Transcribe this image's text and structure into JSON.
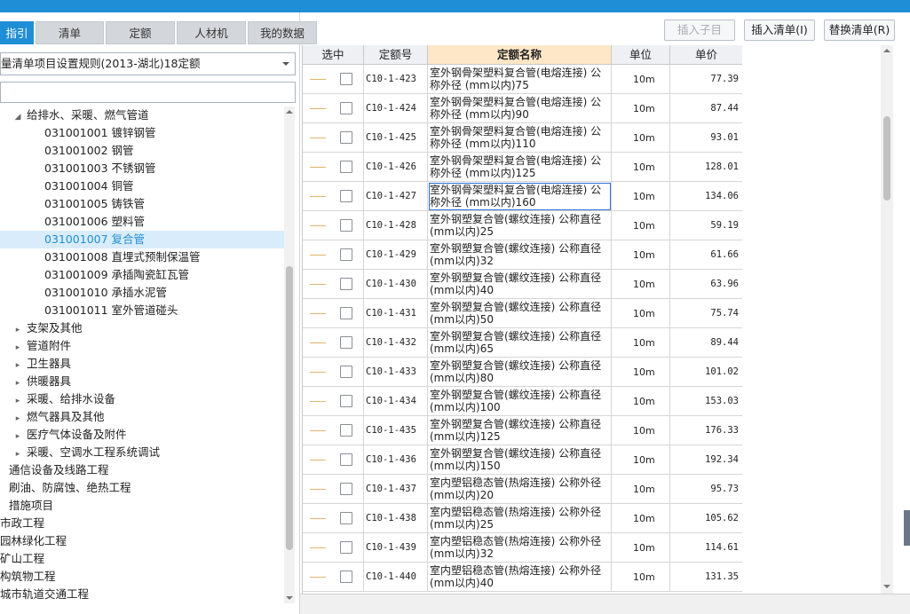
{
  "tabs": [
    "指引",
    "清单",
    "定额",
    "人材机",
    "我的数据"
  ],
  "rule_select": "量清单项目设置规则(2013-湖北)18定额",
  "search_placeholder": "",
  "tree": [
    {
      "label": "给排水、采暖、燃气管道",
      "toggle": "◢",
      "indent": 14,
      "selected": false
    },
    {
      "label": "031001001  镀锌钢管",
      "toggle": "",
      "indent": 50,
      "selected": false
    },
    {
      "label": "031001002  钢管",
      "toggle": "",
      "indent": 50,
      "selected": false
    },
    {
      "label": "031001003  不锈钢管",
      "toggle": "",
      "indent": 50,
      "selected": false
    },
    {
      "label": "031001004  铜管",
      "toggle": "",
      "indent": 50,
      "selected": false
    },
    {
      "label": "031001005  铸铁管",
      "toggle": "",
      "indent": 50,
      "selected": false
    },
    {
      "label": "031001006  塑料管",
      "toggle": "",
      "indent": 50,
      "selected": false
    },
    {
      "label": "031001007  复合管",
      "toggle": "",
      "indent": 50,
      "selected": true
    },
    {
      "label": "031001008  直埋式预制保温管",
      "toggle": "",
      "indent": 50,
      "selected": false
    },
    {
      "label": "031001009  承插陶瓷缸瓦管",
      "toggle": "",
      "indent": 50,
      "selected": false
    },
    {
      "label": "031001010  承插水泥管",
      "toggle": "",
      "indent": 50,
      "selected": false
    },
    {
      "label": "031001011  室外管道碰头",
      "toggle": "",
      "indent": 50,
      "selected": false
    },
    {
      "label": "支架及其他",
      "toggle": "▸",
      "indent": 14,
      "selected": false
    },
    {
      "label": "管道附件",
      "toggle": "▸",
      "indent": 14,
      "selected": false
    },
    {
      "label": "卫生器具",
      "toggle": "▸",
      "indent": 14,
      "selected": false
    },
    {
      "label": "供暖器具",
      "toggle": "▸",
      "indent": 14,
      "selected": false
    },
    {
      "label": "采暖、给排水设备",
      "toggle": "▸",
      "indent": 14,
      "selected": false
    },
    {
      "label": "燃气器具及其他",
      "toggle": "▸",
      "indent": 14,
      "selected": false
    },
    {
      "label": "医疗气体设备及附件",
      "toggle": "▸",
      "indent": 14,
      "selected": false
    },
    {
      "label": "采暖、空调水工程系统调试",
      "toggle": "▸",
      "indent": 14,
      "selected": false
    },
    {
      "label": "通信设备及线路工程",
      "toggle": "",
      "indent": 10,
      "selected": false
    },
    {
      "label": "刷油、防腐蚀、绝热工程",
      "toggle": "",
      "indent": 10,
      "selected": false
    },
    {
      "label": "措施项目",
      "toggle": "",
      "indent": 10,
      "selected": false
    },
    {
      "label": "市政工程",
      "toggle": "",
      "indent": 0,
      "selected": false
    },
    {
      "label": "园林绿化工程",
      "toggle": "",
      "indent": 0,
      "selected": false
    },
    {
      "label": "矿山工程",
      "toggle": "",
      "indent": 0,
      "selected": false
    },
    {
      "label": "构筑物工程",
      "toggle": "",
      "indent": 0,
      "selected": false
    },
    {
      "label": "城市轨道交通工程",
      "toggle": "",
      "indent": 0,
      "selected": false
    }
  ],
  "buttons": {
    "insert_child": "插入子目",
    "insert_list": "插入清单(I)",
    "replace_list": "替换清单(R)"
  },
  "columns": {
    "select": "选中",
    "code": "定额号",
    "name": "定额名称",
    "unit": "单位",
    "price": "单价"
  },
  "rows": [
    {
      "code": "C10-1-423",
      "name": "室外钢骨架塑料复合管(电熔连接) 公称外径 (mm以内)75",
      "unit": "10m",
      "price": "77.39"
    },
    {
      "code": "C10-1-424",
      "name": "室外钢骨架塑料复合管(电熔连接) 公称外径 (mm以内)90",
      "unit": "10m",
      "price": "87.44"
    },
    {
      "code": "C10-1-425",
      "name": "室外钢骨架塑料复合管(电熔连接) 公称外径 (mm以内)110",
      "unit": "10m",
      "price": "93.01"
    },
    {
      "code": "C10-1-426",
      "name": "室外钢骨架塑料复合管(电熔连接) 公称外径 (mm以内)125",
      "unit": "10m",
      "price": "128.01"
    },
    {
      "code": "C10-1-427",
      "name": "室外钢骨架塑料复合管(电熔连接) 公称外径 (mm以内)160",
      "unit": "10m",
      "price": "134.06"
    },
    {
      "code": "C10-1-428",
      "name": "室外钢塑复合管(螺纹连接) 公称直径 (mm以内)25",
      "unit": "10m",
      "price": "59.19"
    },
    {
      "code": "C10-1-429",
      "name": "室外钢塑复合管(螺纹连接) 公称直径 (mm以内)32",
      "unit": "10m",
      "price": "61.66"
    },
    {
      "code": "C10-1-430",
      "name": "室外钢塑复合管(螺纹连接) 公称直径 (mm以内)40",
      "unit": "10m",
      "price": "63.96"
    },
    {
      "code": "C10-1-431",
      "name": "室外钢塑复合管(螺纹连接) 公称直径 (mm以内)50",
      "unit": "10m",
      "price": "75.74"
    },
    {
      "code": "C10-1-432",
      "name": "室外钢塑复合管(螺纹连接) 公称直径 (mm以内)65",
      "unit": "10m",
      "price": "89.44"
    },
    {
      "code": "C10-1-433",
      "name": "室外钢塑复合管(螺纹连接) 公称直径 (mm以内)80",
      "unit": "10m",
      "price": "101.02"
    },
    {
      "code": "C10-1-434",
      "name": "室外钢塑复合管(螺纹连接) 公称直径 (mm以内)100",
      "unit": "10m",
      "price": "153.03"
    },
    {
      "code": "C10-1-435",
      "name": "室外钢塑复合管(螺纹连接) 公称直径 (mm以内)125",
      "unit": "10m",
      "price": "176.33"
    },
    {
      "code": "C10-1-436",
      "name": "室外钢塑复合管(螺纹连接) 公称直径 (mm以内)150",
      "unit": "10m",
      "price": "192.34"
    },
    {
      "code": "C10-1-437",
      "name": "室内塑铝稳态管(热熔连接) 公称外径 (mm以内)20",
      "unit": "10m",
      "price": "95.73"
    },
    {
      "code": "C10-1-438",
      "name": "室内塑铝稳态管(热熔连接) 公称外径 (mm以内)25",
      "unit": "10m",
      "price": "105.62"
    },
    {
      "code": "C10-1-439",
      "name": "室内塑铝稳态管(热熔连接) 公称外径 (mm以内)32",
      "unit": "10m",
      "price": "114.61"
    },
    {
      "code": "C10-1-440",
      "name": "室内塑铝稳态管(热熔连接) 公称外径 (mm以内)40",
      "unit": "10m",
      "price": "131.35"
    }
  ]
}
